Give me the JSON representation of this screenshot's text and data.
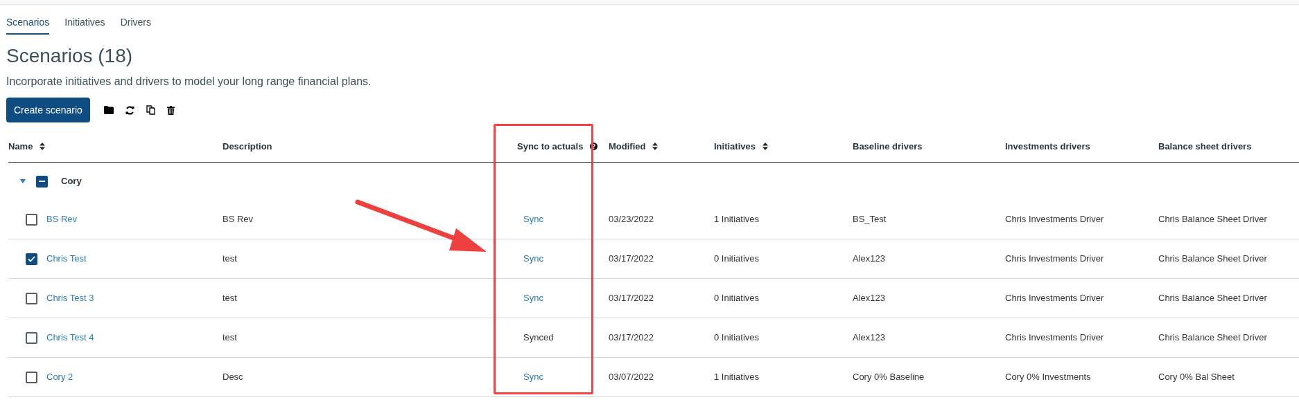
{
  "tabs": [
    {
      "label": "Scenarios",
      "selected": true
    },
    {
      "label": "Initiatives",
      "selected": false
    },
    {
      "label": "Drivers",
      "selected": false
    }
  ],
  "title": "Scenarios (18)",
  "subtitle": "Incorporate initiatives and drivers to model your long range financial plans.",
  "create_button": "Create scenario",
  "table": {
    "columns": [
      {
        "label": "Name",
        "sortable": true,
        "help": false
      },
      {
        "label": "Description",
        "sortable": false,
        "help": false
      },
      {
        "label": "Sync to actuals",
        "sortable": false,
        "help": true
      },
      {
        "label": "Modified",
        "sortable": true,
        "help": false
      },
      {
        "label": "Initiatives",
        "sortable": true,
        "help": false
      },
      {
        "label": "Baseline drivers",
        "sortable": false,
        "help": false
      },
      {
        "label": "Investments drivers",
        "sortable": false,
        "help": false
      },
      {
        "label": "Balance sheet drivers",
        "sortable": false,
        "help": false
      }
    ],
    "group": {
      "name": "Cory",
      "expanded": true,
      "indeterminate": true
    },
    "rows": [
      {
        "checked": false,
        "cells": [
          "BS Rev",
          "BS Rev",
          "Sync",
          "03/23/2022",
          "1 Initiatives",
          "BS_Test",
          "Chris Investments Driver",
          "Chris Balance Sheet Driver"
        ],
        "sync_link": true
      },
      {
        "checked": true,
        "cells": [
          "Chris Test",
          "test",
          "Sync",
          "03/17/2022",
          "0 Initiatives",
          "Alex123",
          "Chris Investments Driver",
          "Chris Balance Sheet Driver"
        ],
        "sync_link": true
      },
      {
        "checked": false,
        "cells": [
          "Chris Test 3",
          "test",
          "Sync",
          "03/17/2022",
          "0 Initiatives",
          "Alex123",
          "Chris Investments Driver",
          "Chris Balance Sheet Driver"
        ],
        "sync_link": true
      },
      {
        "checked": false,
        "cells": [
          "Chris Test 4",
          "test",
          "Synced",
          "03/17/2022",
          "0 Initiatives",
          "Alex123",
          "Chris Investments Driver",
          "Chris Balance Sheet Driver"
        ],
        "sync_link": false
      },
      {
        "checked": false,
        "cells": [
          "Cory 2",
          "Desc",
          "Sync",
          "03/07/2022",
          "1 Initiatives",
          "Cory 0% Baseline",
          "Cory 0% Investments",
          "Cory 0% Bal Sheet"
        ],
        "sync_link": true
      }
    ]
  }
}
